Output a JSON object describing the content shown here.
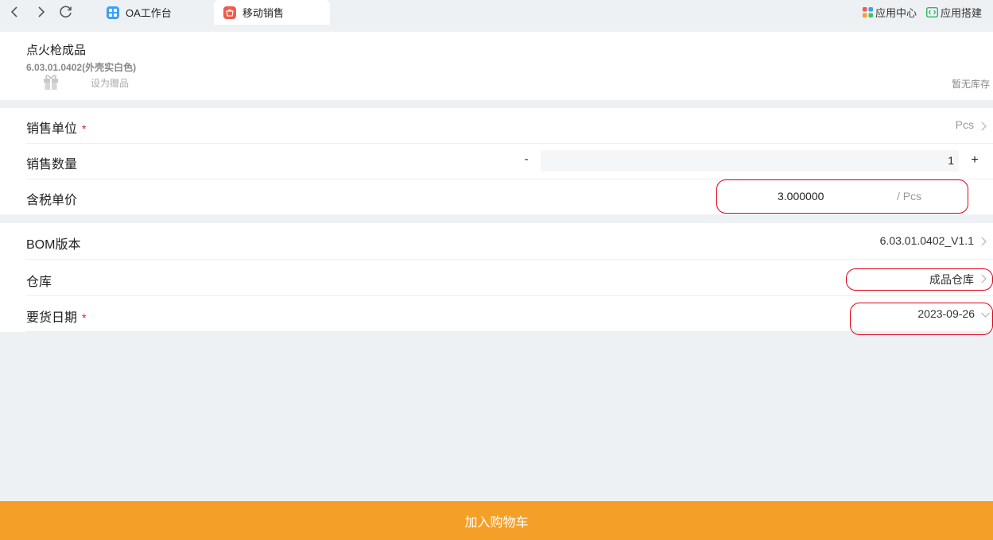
{
  "browser": {
    "tabs": [
      {
        "label": "OA工作台",
        "icon": "grid-app-icon",
        "color": "#3ba1f5"
      },
      {
        "label": "移动销售",
        "icon": "shop-app-icon",
        "color": "#f25a4a"
      }
    ],
    "right_links": [
      {
        "label": "应用中心",
        "icon": "apps-icon"
      },
      {
        "label": "应用搭建",
        "icon": "code-build-icon"
      }
    ]
  },
  "product": {
    "name": "点火枪成品",
    "code": "6.03.01.0402(外壳实白色)",
    "gift_label": "设为赠品",
    "stock_label": "暂无库存"
  },
  "form": {
    "sales_unit": {
      "label": "销售单位",
      "required": "*",
      "value": "Pcs"
    },
    "sales_qty": {
      "label": "销售数量",
      "minus": "-",
      "value": "1",
      "plus": "+"
    },
    "unit_price": {
      "label": "含税单价",
      "value": "3.000000",
      "unit": "/ Pcs"
    },
    "bom_version": {
      "label": "BOM版本",
      "value": "6.03.01.0402_V1.1"
    },
    "warehouse": {
      "label": "仓库",
      "value": "成品仓库"
    },
    "delivery_date": {
      "label": "要货日期",
      "required": "*",
      "value": "2023-09-26"
    }
  },
  "actions": {
    "add_to_cart": "加入购物车"
  },
  "colors": {
    "accent": "#f4a028",
    "required": "#e02020",
    "annotation": "#e0001b",
    "page_bg": "#eef1f4"
  }
}
